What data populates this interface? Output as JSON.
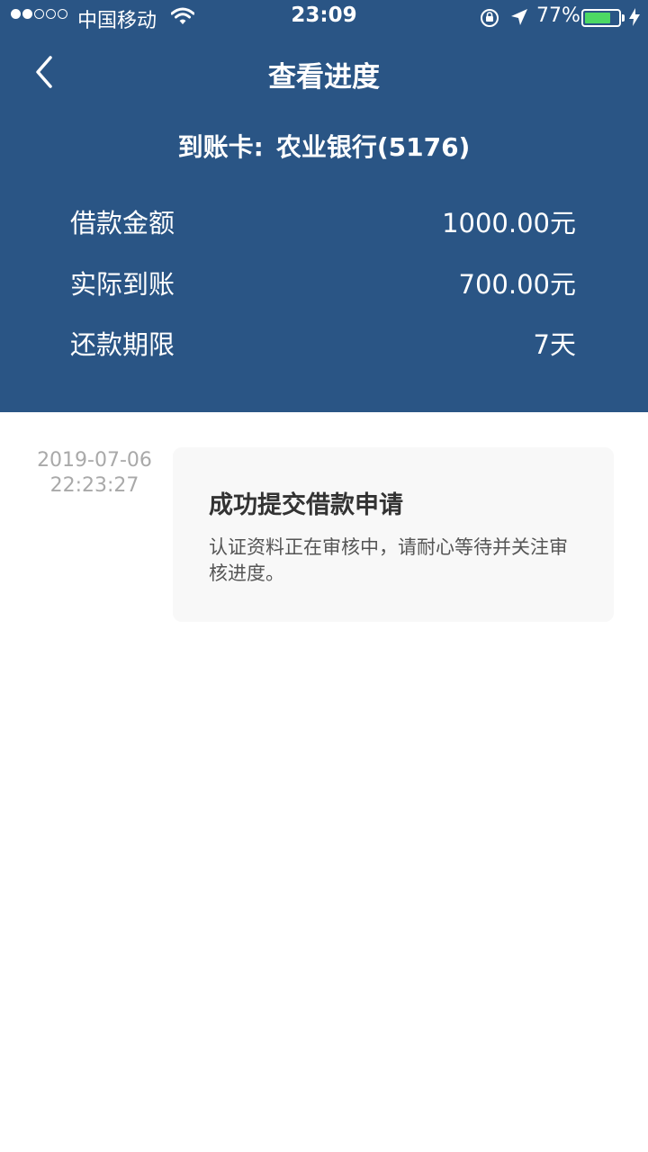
{
  "status_bar": {
    "carrier": "中国移动",
    "time": "23:09",
    "battery_percent": "77%",
    "battery_level": 0.77,
    "signal_filled": 2,
    "signal_total": 5
  },
  "nav": {
    "title": "查看进度"
  },
  "card": {
    "label": "到账卡:",
    "value": "农业银行(5176)"
  },
  "details": [
    {
      "label": "借款金额",
      "value": "1000.00元"
    },
    {
      "label": "实际到账",
      "value": "700.00元"
    },
    {
      "label": "还款期限",
      "value": "7天"
    }
  ],
  "timeline": [
    {
      "date": "2019-07-06",
      "time": "22:23:27",
      "title": "成功提交借款申请",
      "desc": "认证资料正在审核中，请耐心等待并关注审核进度。"
    }
  ],
  "colors": {
    "header_bg": "#2a5585",
    "battery": "#4cd964"
  }
}
